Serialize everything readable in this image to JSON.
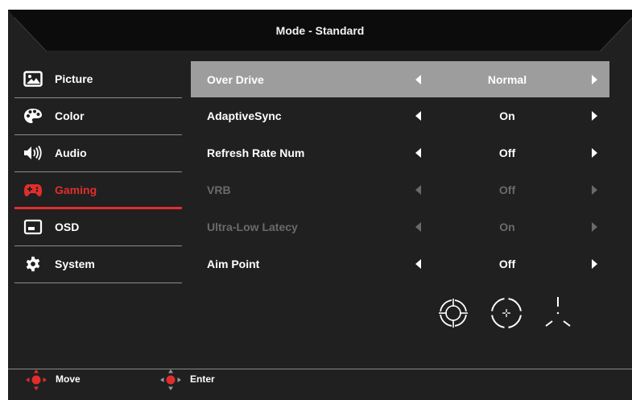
{
  "header": {
    "title": "Mode - Standard"
  },
  "menu": {
    "items": [
      {
        "label": "Picture",
        "icon": "picture-icon",
        "active": false
      },
      {
        "label": "Color",
        "icon": "palette-icon",
        "active": false
      },
      {
        "label": "Audio",
        "icon": "speaker-icon",
        "active": false
      },
      {
        "label": "Gaming",
        "icon": "gamepad-icon",
        "active": true
      },
      {
        "label": "OSD",
        "icon": "osd-window-icon",
        "active": false
      },
      {
        "label": "System",
        "icon": "gear-icon",
        "active": false
      }
    ]
  },
  "settings": {
    "rows": [
      {
        "name": "Over Drive",
        "value": "Normal",
        "selected": true,
        "enabled": true
      },
      {
        "name": "AdaptiveSync",
        "value": "On",
        "selected": false,
        "enabled": true
      },
      {
        "name": "Refresh Rate Num",
        "value": "Off",
        "selected": false,
        "enabled": true
      },
      {
        "name": "VRB",
        "value": "Off",
        "selected": false,
        "enabled": false
      },
      {
        "name": "Ultra-Low Latecy",
        "value": "On",
        "selected": false,
        "enabled": false
      },
      {
        "name": "Aim Point",
        "value": "Off",
        "selected": false,
        "enabled": true
      }
    ],
    "aim_point_options": [
      "crosshair-circle-icon",
      "crosshair-dot-icon",
      "crosshair-tri-icon"
    ]
  },
  "footer": {
    "move_label": "Move",
    "enter_label": "Enter"
  },
  "colors": {
    "background": "#202020",
    "accent": "#e22d2d",
    "selected_row": "#9d9d9d",
    "disabled_text": "#6a6a6a"
  }
}
